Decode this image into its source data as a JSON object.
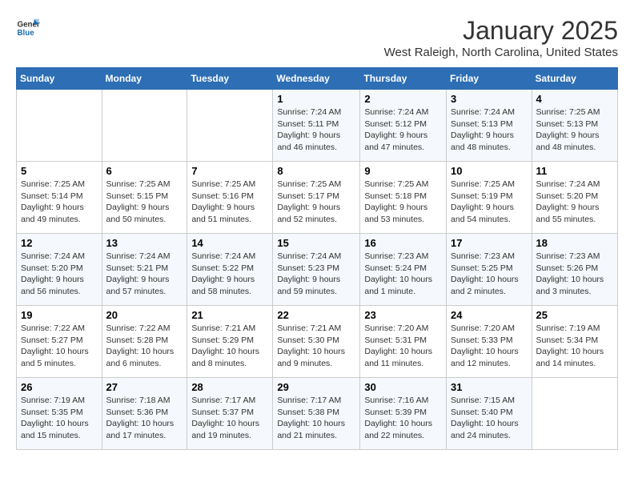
{
  "logo": {
    "line1": "General",
    "line2": "Blue"
  },
  "title": "January 2025",
  "subtitle": "West Raleigh, North Carolina, United States",
  "days_of_week": [
    "Sunday",
    "Monday",
    "Tuesday",
    "Wednesday",
    "Thursday",
    "Friday",
    "Saturday"
  ],
  "weeks": [
    [
      {
        "day": "",
        "sunrise": "",
        "sunset": "",
        "daylight": ""
      },
      {
        "day": "",
        "sunrise": "",
        "sunset": "",
        "daylight": ""
      },
      {
        "day": "",
        "sunrise": "",
        "sunset": "",
        "daylight": ""
      },
      {
        "day": "1",
        "sunrise": "Sunrise: 7:24 AM",
        "sunset": "Sunset: 5:11 PM",
        "daylight": "Daylight: 9 hours and 46 minutes."
      },
      {
        "day": "2",
        "sunrise": "Sunrise: 7:24 AM",
        "sunset": "Sunset: 5:12 PM",
        "daylight": "Daylight: 9 hours and 47 minutes."
      },
      {
        "day": "3",
        "sunrise": "Sunrise: 7:24 AM",
        "sunset": "Sunset: 5:13 PM",
        "daylight": "Daylight: 9 hours and 48 minutes."
      },
      {
        "day": "4",
        "sunrise": "Sunrise: 7:25 AM",
        "sunset": "Sunset: 5:13 PM",
        "daylight": "Daylight: 9 hours and 48 minutes."
      }
    ],
    [
      {
        "day": "5",
        "sunrise": "Sunrise: 7:25 AM",
        "sunset": "Sunset: 5:14 PM",
        "daylight": "Daylight: 9 hours and 49 minutes."
      },
      {
        "day": "6",
        "sunrise": "Sunrise: 7:25 AM",
        "sunset": "Sunset: 5:15 PM",
        "daylight": "Daylight: 9 hours and 50 minutes."
      },
      {
        "day": "7",
        "sunrise": "Sunrise: 7:25 AM",
        "sunset": "Sunset: 5:16 PM",
        "daylight": "Daylight: 9 hours and 51 minutes."
      },
      {
        "day": "8",
        "sunrise": "Sunrise: 7:25 AM",
        "sunset": "Sunset: 5:17 PM",
        "daylight": "Daylight: 9 hours and 52 minutes."
      },
      {
        "day": "9",
        "sunrise": "Sunrise: 7:25 AM",
        "sunset": "Sunset: 5:18 PM",
        "daylight": "Daylight: 9 hours and 53 minutes."
      },
      {
        "day": "10",
        "sunrise": "Sunrise: 7:25 AM",
        "sunset": "Sunset: 5:19 PM",
        "daylight": "Daylight: 9 hours and 54 minutes."
      },
      {
        "day": "11",
        "sunrise": "Sunrise: 7:24 AM",
        "sunset": "Sunset: 5:20 PM",
        "daylight": "Daylight: 9 hours and 55 minutes."
      }
    ],
    [
      {
        "day": "12",
        "sunrise": "Sunrise: 7:24 AM",
        "sunset": "Sunset: 5:20 PM",
        "daylight": "Daylight: 9 hours and 56 minutes."
      },
      {
        "day": "13",
        "sunrise": "Sunrise: 7:24 AM",
        "sunset": "Sunset: 5:21 PM",
        "daylight": "Daylight: 9 hours and 57 minutes."
      },
      {
        "day": "14",
        "sunrise": "Sunrise: 7:24 AM",
        "sunset": "Sunset: 5:22 PM",
        "daylight": "Daylight: 9 hours and 58 minutes."
      },
      {
        "day": "15",
        "sunrise": "Sunrise: 7:24 AM",
        "sunset": "Sunset: 5:23 PM",
        "daylight": "Daylight: 9 hours and 59 minutes."
      },
      {
        "day": "16",
        "sunrise": "Sunrise: 7:23 AM",
        "sunset": "Sunset: 5:24 PM",
        "daylight": "Daylight: 10 hours and 1 minute."
      },
      {
        "day": "17",
        "sunrise": "Sunrise: 7:23 AM",
        "sunset": "Sunset: 5:25 PM",
        "daylight": "Daylight: 10 hours and 2 minutes."
      },
      {
        "day": "18",
        "sunrise": "Sunrise: 7:23 AM",
        "sunset": "Sunset: 5:26 PM",
        "daylight": "Daylight: 10 hours and 3 minutes."
      }
    ],
    [
      {
        "day": "19",
        "sunrise": "Sunrise: 7:22 AM",
        "sunset": "Sunset: 5:27 PM",
        "daylight": "Daylight: 10 hours and 5 minutes."
      },
      {
        "day": "20",
        "sunrise": "Sunrise: 7:22 AM",
        "sunset": "Sunset: 5:28 PM",
        "daylight": "Daylight: 10 hours and 6 minutes."
      },
      {
        "day": "21",
        "sunrise": "Sunrise: 7:21 AM",
        "sunset": "Sunset: 5:29 PM",
        "daylight": "Daylight: 10 hours and 8 minutes."
      },
      {
        "day": "22",
        "sunrise": "Sunrise: 7:21 AM",
        "sunset": "Sunset: 5:30 PM",
        "daylight": "Daylight: 10 hours and 9 minutes."
      },
      {
        "day": "23",
        "sunrise": "Sunrise: 7:20 AM",
        "sunset": "Sunset: 5:31 PM",
        "daylight": "Daylight: 10 hours and 11 minutes."
      },
      {
        "day": "24",
        "sunrise": "Sunrise: 7:20 AM",
        "sunset": "Sunset: 5:33 PM",
        "daylight": "Daylight: 10 hours and 12 minutes."
      },
      {
        "day": "25",
        "sunrise": "Sunrise: 7:19 AM",
        "sunset": "Sunset: 5:34 PM",
        "daylight": "Daylight: 10 hours and 14 minutes."
      }
    ],
    [
      {
        "day": "26",
        "sunrise": "Sunrise: 7:19 AM",
        "sunset": "Sunset: 5:35 PM",
        "daylight": "Daylight: 10 hours and 15 minutes."
      },
      {
        "day": "27",
        "sunrise": "Sunrise: 7:18 AM",
        "sunset": "Sunset: 5:36 PM",
        "daylight": "Daylight: 10 hours and 17 minutes."
      },
      {
        "day": "28",
        "sunrise": "Sunrise: 7:17 AM",
        "sunset": "Sunset: 5:37 PM",
        "daylight": "Daylight: 10 hours and 19 minutes."
      },
      {
        "day": "29",
        "sunrise": "Sunrise: 7:17 AM",
        "sunset": "Sunset: 5:38 PM",
        "daylight": "Daylight: 10 hours and 21 minutes."
      },
      {
        "day": "30",
        "sunrise": "Sunrise: 7:16 AM",
        "sunset": "Sunset: 5:39 PM",
        "daylight": "Daylight: 10 hours and 22 minutes."
      },
      {
        "day": "31",
        "sunrise": "Sunrise: 7:15 AM",
        "sunset": "Sunset: 5:40 PM",
        "daylight": "Daylight: 10 hours and 24 minutes."
      },
      {
        "day": "",
        "sunrise": "",
        "sunset": "",
        "daylight": ""
      }
    ]
  ]
}
